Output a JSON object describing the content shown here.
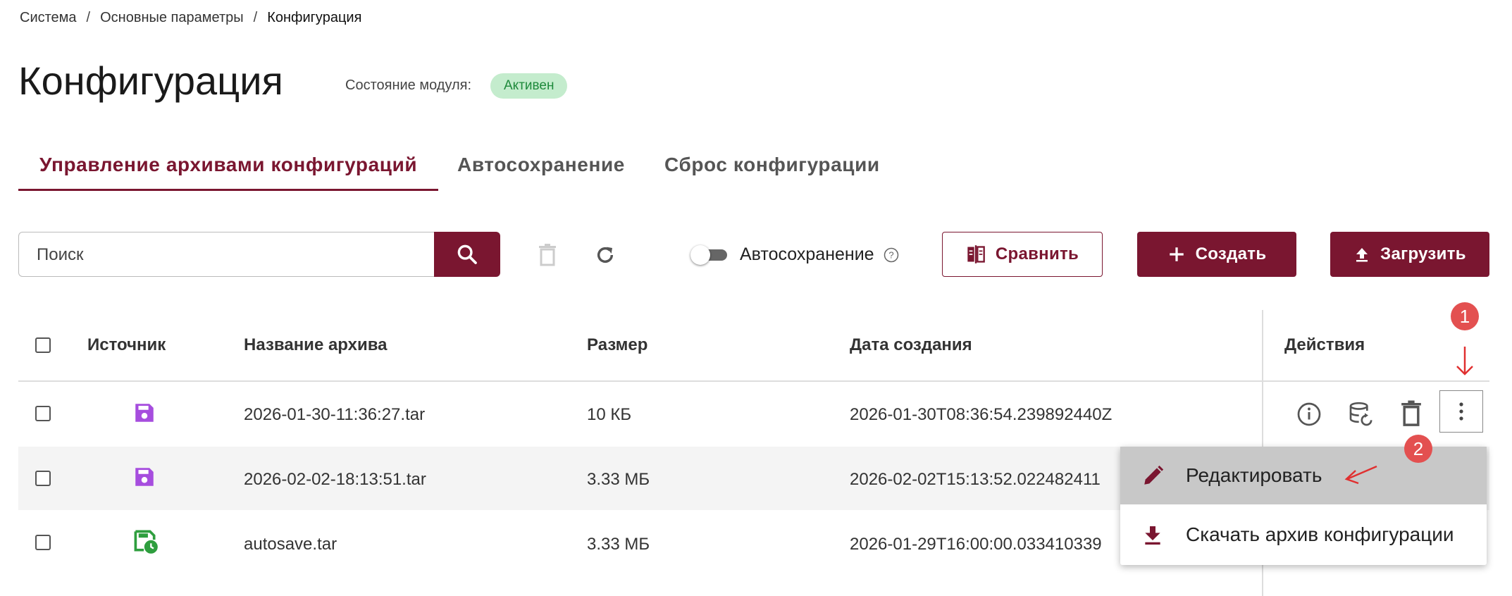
{
  "breadcrumb": {
    "items": [
      "Система",
      "Основные параметры",
      "Конфигурация"
    ],
    "separator": "/"
  },
  "page": {
    "title": "Конфигурация",
    "status_label": "Состояние модуля:",
    "status_value": "Активен"
  },
  "tabs": [
    {
      "label": "Управление архивами конфигураций",
      "active": true
    },
    {
      "label": "Автосохранение",
      "active": false
    },
    {
      "label": "Сброс конфигурации",
      "active": false
    }
  ],
  "toolbar": {
    "search_placeholder": "Поиск",
    "autosave_label": "Автосохранение",
    "autosave_enabled": false,
    "compare_label": "Сравнить",
    "create_label": "Создать",
    "upload_label": "Загрузить"
  },
  "table": {
    "headers": {
      "source": "Источник",
      "name": "Название архива",
      "size": "Размер",
      "date": "Дата создания",
      "actions": "Действия"
    },
    "rows": [
      {
        "source_icon": "save-icon",
        "name": "2026-01-30-11:36:27.tar",
        "size": "10 КБ",
        "date": "2026-01-30T08:36:54.239892440Z"
      },
      {
        "source_icon": "save-icon",
        "name": "2026-02-02-18:13:51.tar",
        "size": "3.33 МБ",
        "date": "2026-02-02T15:13:52.022482411"
      },
      {
        "source_icon": "autosave-icon",
        "name": "autosave.tar",
        "size": "3.33 МБ",
        "date": "2026-01-29T16:00:00.033410339"
      }
    ]
  },
  "menu": {
    "items": [
      {
        "label": "Редактировать",
        "icon": "pencil-icon"
      },
      {
        "label": "Скачать архив конфигурации",
        "icon": "download-icon"
      }
    ]
  },
  "annotations": [
    "1",
    "2"
  ],
  "colors": {
    "accent": "#7a1630",
    "badge_bg": "#c4eccd",
    "badge_text": "#1f8a3c",
    "source_icon": "#a64dde",
    "autosave_icon": "#2e9e3e",
    "annotation": "#e35050"
  }
}
